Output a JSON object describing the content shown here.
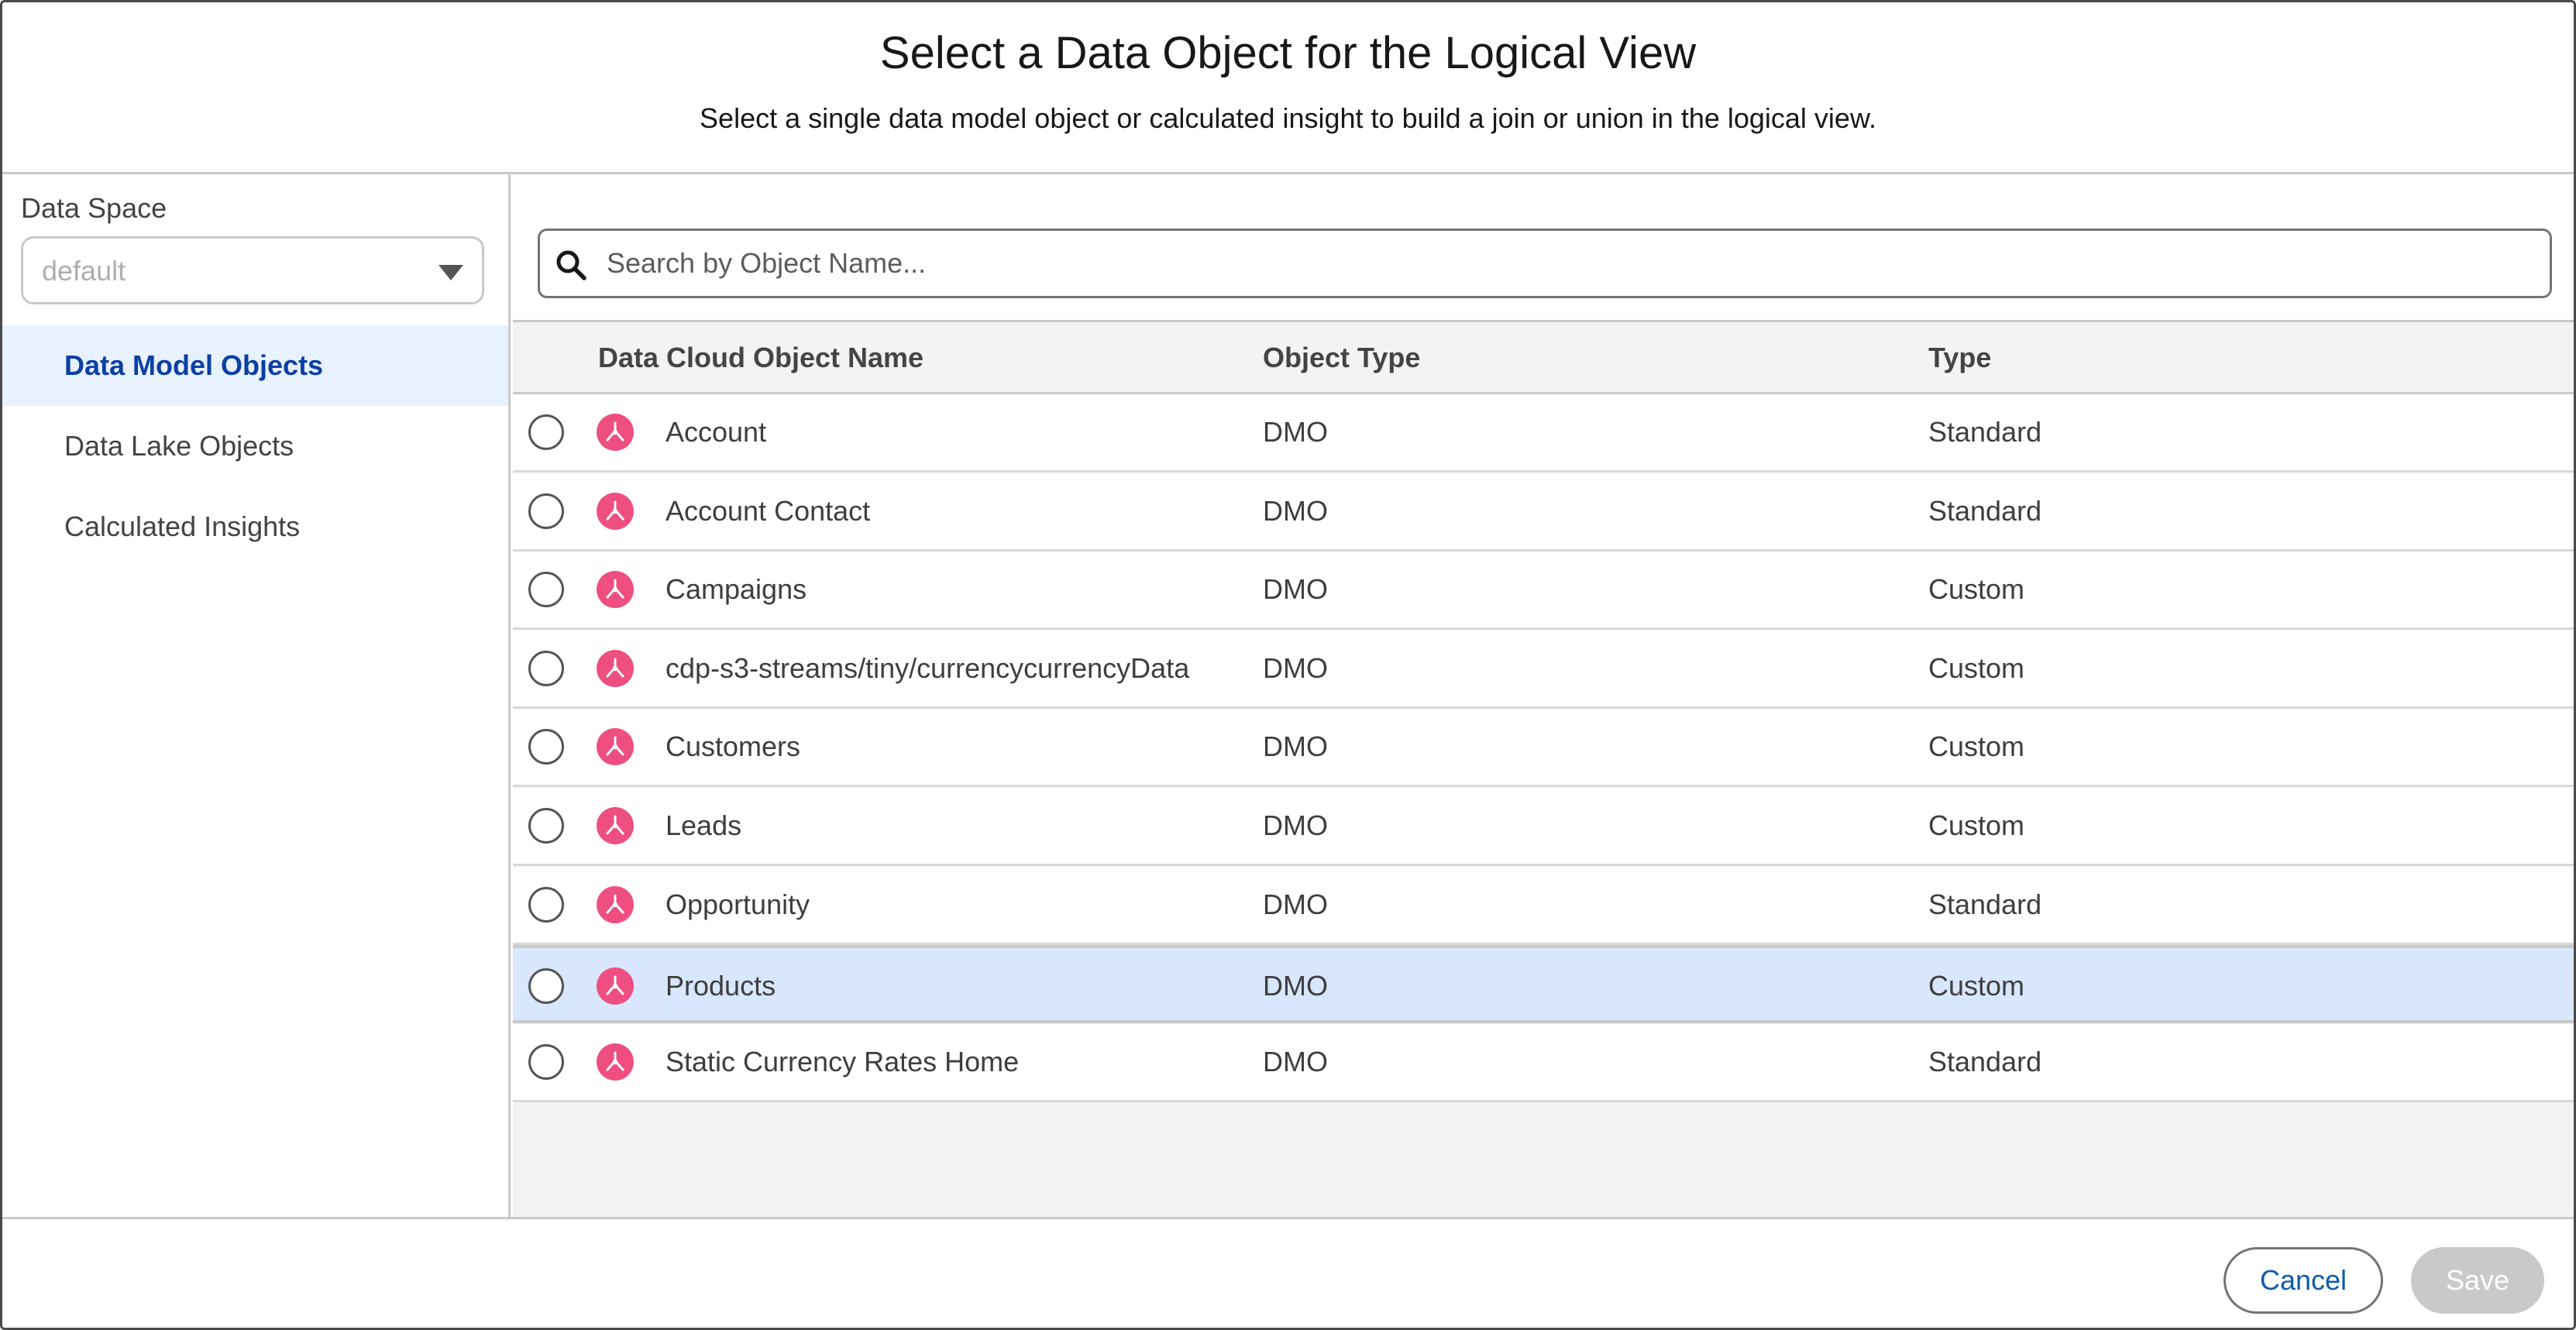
{
  "dialog": {
    "title": "Select a Data Object for the Logical View",
    "subtitle": "Select a single data model object or calculated insight to build a join or union in the logical view."
  },
  "sidebar": {
    "data_space_label": "Data Space",
    "data_space_value": "default",
    "items": [
      {
        "label": "Data Model Objects",
        "active": true
      },
      {
        "label": "Data Lake Objects",
        "active": false
      },
      {
        "label": "Calculated Insights",
        "active": false
      }
    ]
  },
  "search": {
    "placeholder": "Search by Object Name..."
  },
  "table": {
    "columns": [
      "Data Cloud Object Name",
      "Object Type",
      "Type"
    ],
    "rows": [
      {
        "name": "Account",
        "object_type": "DMO",
        "type": "Standard",
        "selected": false
      },
      {
        "name": "Account Contact",
        "object_type": "DMO",
        "type": "Standard",
        "selected": false
      },
      {
        "name": "Campaigns",
        "object_type": "DMO",
        "type": "Custom",
        "selected": false
      },
      {
        "name": "cdp-s3-streams/tiny/currencycurrencyData",
        "object_type": "DMO",
        "type": "Custom",
        "selected": false
      },
      {
        "name": "Customers",
        "object_type": "DMO",
        "type": "Custom",
        "selected": false
      },
      {
        "name": "Leads",
        "object_type": "DMO",
        "type": "Custom",
        "selected": false
      },
      {
        "name": "Opportunity",
        "object_type": "DMO",
        "type": "Standard",
        "selected": false
      },
      {
        "name": "Products",
        "object_type": "DMO",
        "type": "Custom",
        "selected": true
      },
      {
        "name": "Static Currency Rates Home",
        "object_type": "DMO",
        "type": "Standard",
        "selected": false
      }
    ]
  },
  "footer": {
    "cancel_label": "Cancel",
    "save_label": "Save"
  },
  "colors": {
    "accent": "#0b5cab",
    "active_nav_bg": "#e8f1fe",
    "selected_row_bg": "#d8e6fe",
    "object_icon_bg": "#ef4e81"
  },
  "icons": {
    "search": "search-icon",
    "dropdown": "triangle-down-icon",
    "data_object": "data-model-object-icon"
  }
}
